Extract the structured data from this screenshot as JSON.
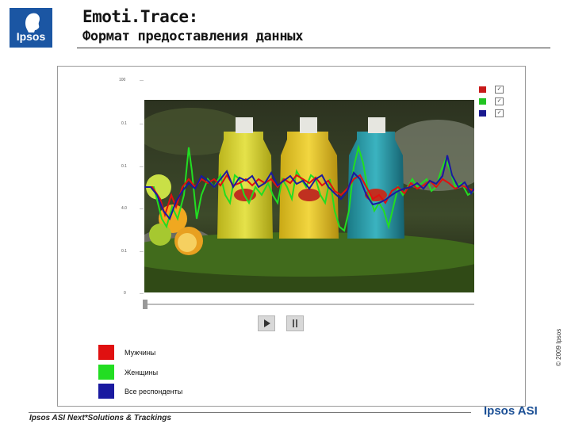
{
  "header": {
    "logo_text": "Ipsos",
    "title_line1": "Emoti.Trace:",
    "title_line2": "Формат предоставления данных"
  },
  "copyright": "© 2009 Ipsos",
  "chart": {
    "y_ticks": [
      "100",
      "0.1",
      "0.1",
      "4.0",
      "0.1",
      "0"
    ],
    "series_colors": {
      "men": "#e01010",
      "women": "#22dd22",
      "all": "#1a1aa0"
    },
    "series_visible": [
      true,
      true,
      true
    ],
    "playback_position": 0
  },
  "legend": [
    {
      "label": "Мужчины",
      "color": "#e01010"
    },
    {
      "label": "Женщины",
      "color": "#22dd22"
    },
    {
      "label": "Все респонденты",
      "color": "#1a1aa0"
    }
  ],
  "footer": {
    "text": "Ipsos ASI Next*Solutions & Trackings",
    "brand": "Ipsos ASI"
  },
  "icons": {
    "play": "play-icon",
    "pause": "pause-icon"
  }
}
